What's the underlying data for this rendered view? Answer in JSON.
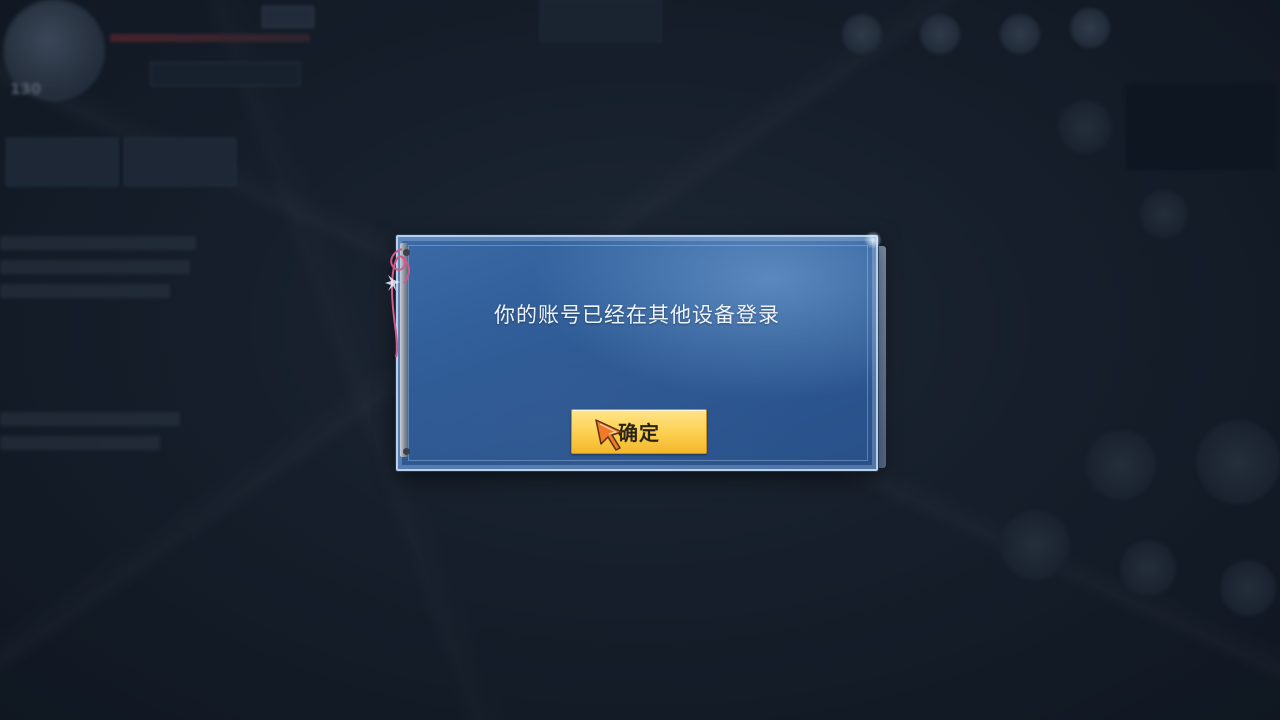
{
  "background": {
    "player_level": "130"
  },
  "dialog": {
    "message": "你的账号已经在其他设备登录",
    "confirm_button": {
      "label": "确定"
    },
    "icons": {
      "cursor": "pointer-cursor-icon",
      "ribbon": "ribbon-icon"
    }
  },
  "colors": {
    "dialog_bg": "#2d5b96",
    "dialog_border": "#b6d0ec",
    "button_bg": "#fccf4e",
    "button_text": "#2a2416",
    "message_text": "#eef4fb"
  }
}
